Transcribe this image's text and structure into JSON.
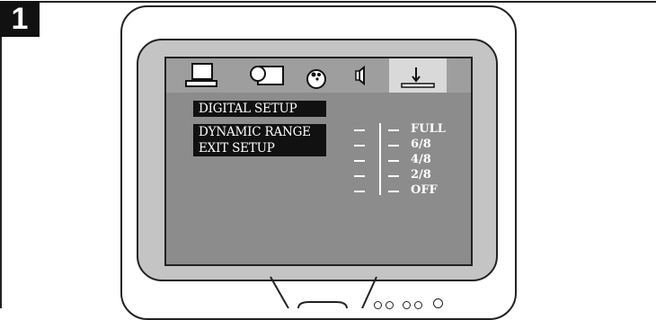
{
  "step": {
    "number": "1"
  },
  "menu": {
    "tabs": [
      {
        "icon": "tv-icon"
      },
      {
        "icon": "speech-bubble-icon"
      },
      {
        "icon": "disc-icon"
      },
      {
        "icon": "speaker-icon"
      },
      {
        "icon": "digital-setup-icon",
        "active": true
      }
    ],
    "items": [
      "DIGITAL SETUP",
      "DYNAMIC RANGE",
      "EXIT SETUP"
    ],
    "levels": [
      "FULL",
      "6/8",
      "4/8",
      "2/8",
      "OFF"
    ]
  },
  "colors": {
    "screen": "#8c8c8c",
    "highlight": "#111111",
    "active_tab": "#d9d9d9"
  }
}
